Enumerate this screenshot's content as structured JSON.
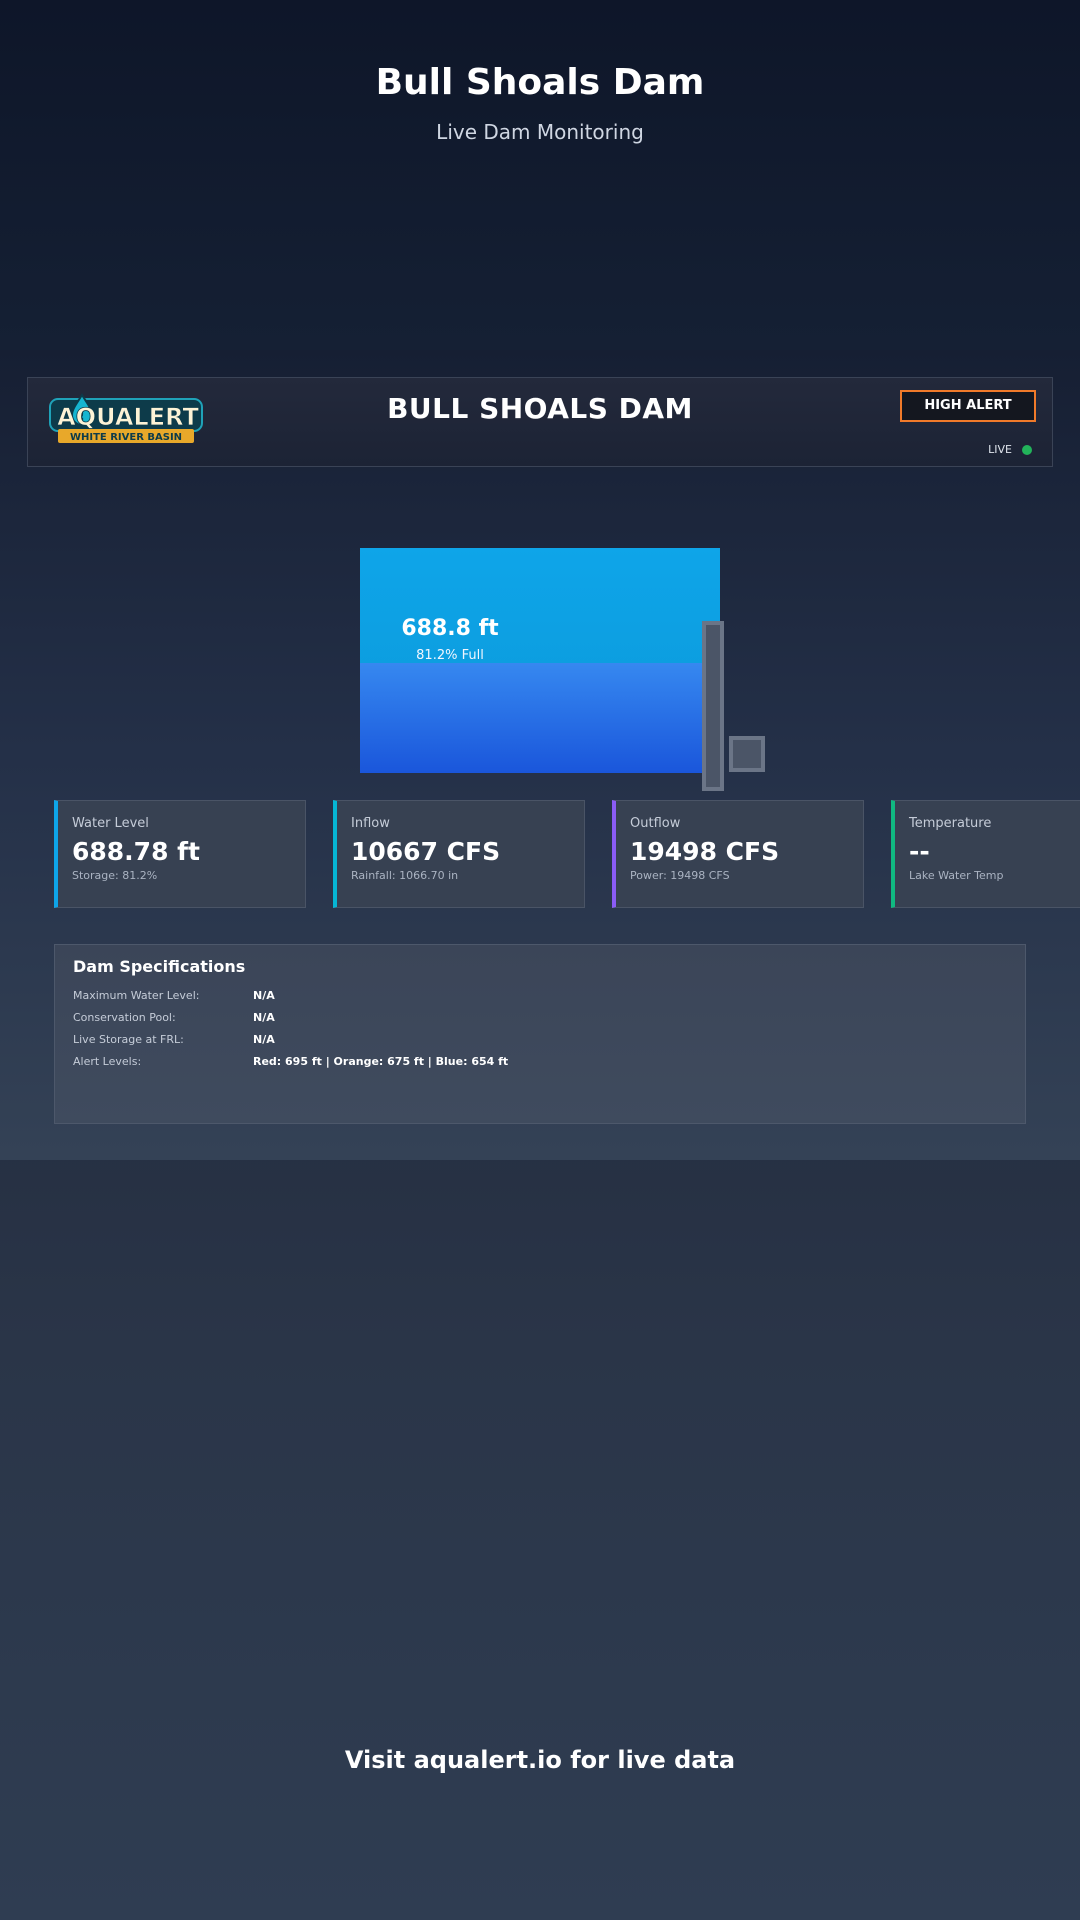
{
  "header": {
    "title": "Bull Shoals Dam",
    "subtitle": "Live Dam Monitoring"
  },
  "panel": {
    "logo_text": "AQUALERT",
    "logo_subtext": "WHITE RIVER BASIN",
    "dam_name": "BULL SHOALS DAM",
    "alert_label": "HIGH ALERT",
    "alert_color": "#f07a2a",
    "live_label": "LIVE",
    "live_color": "#22b35a"
  },
  "reservoir": {
    "level_label": "688.8 ft",
    "fill_label": "81.2% Full"
  },
  "cards": [
    {
      "label": "Water Level",
      "value": "688.78 ft",
      "sub": "Storage: 81.2%",
      "accent": "#0ea5e9"
    },
    {
      "label": "Inflow",
      "value": "10667 CFS",
      "sub": "Rainfall: 1066.70 in",
      "accent": "#06b6d4"
    },
    {
      "label": "Outflow",
      "value": "19498 CFS",
      "sub": "Power: 19498 CFS",
      "accent": "#8b5cf6"
    },
    {
      "label": "Temperature",
      "value": "--",
      "sub": "Lake Water Temp",
      "accent": "#10b981"
    }
  ],
  "specs": {
    "title": "Dam Specifications",
    "rows": [
      {
        "label": "Maximum Water Level:",
        "value": "N/A"
      },
      {
        "label": "Conservation Pool:",
        "value": "N/A"
      },
      {
        "label": "Live Storage at FRL:",
        "value": "N/A"
      },
      {
        "label": "Alert Levels:",
        "value": "Red: 695 ft | Orange: 675 ft | Blue: 654 ft"
      }
    ]
  },
  "footer": {
    "cta": "Visit aqualert.io for live data"
  }
}
